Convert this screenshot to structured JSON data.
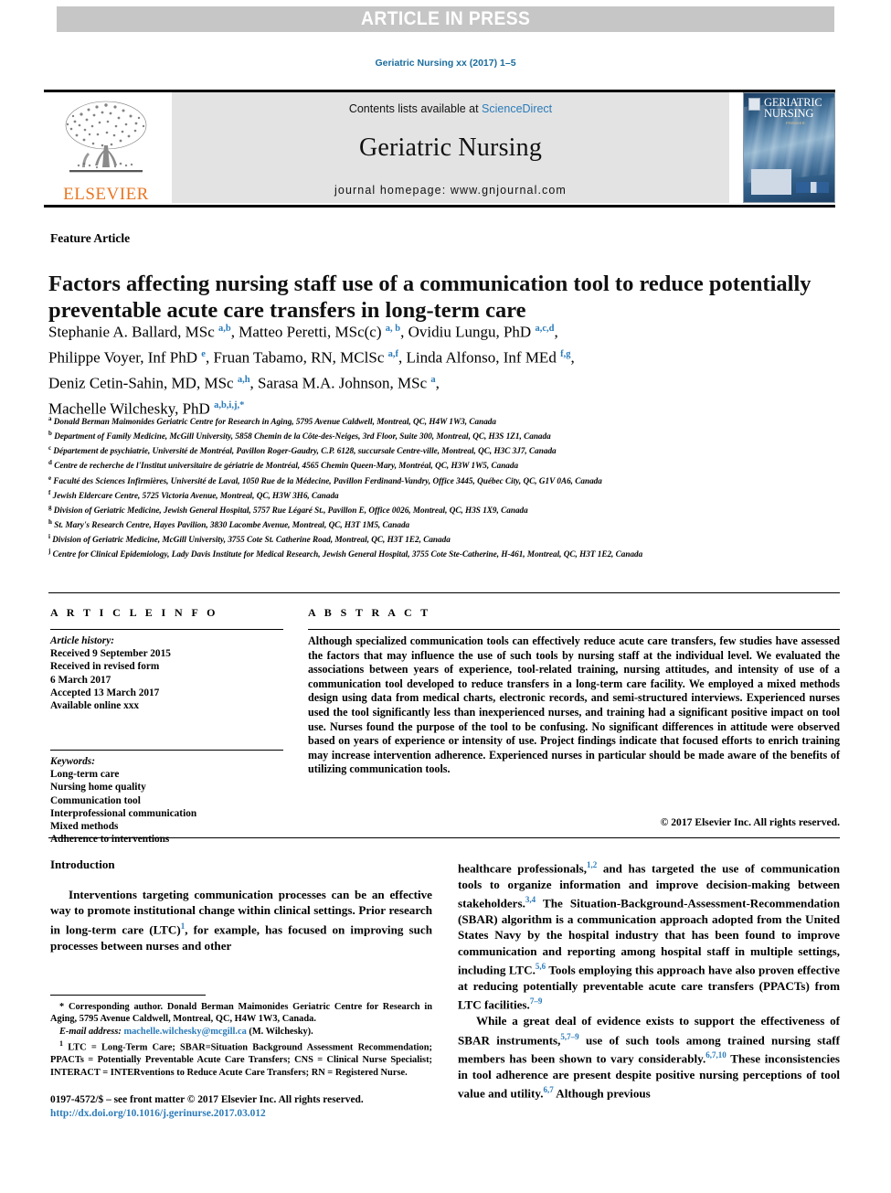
{
  "banner": {
    "text": "ARTICLE IN PRESS"
  },
  "running_head": "Geriatric Nursing xx (2017) 1–5",
  "masthead": {
    "contents_prefix": "Contents lists available at ",
    "sciencedirect": "ScienceDirect",
    "journal_title": "Geriatric Nursing",
    "homepage": "journal homepage: www.gnjournal.com",
    "publisher_wordmark": "ELSEVIER",
    "cover_title_line1": "GERIATRIC",
    "cover_title_line2": "NURSING",
    "cover_subtitle": "PREMIER"
  },
  "article": {
    "type_label": "Feature Article",
    "title": "Factors affecting nursing staff use of a communication tool to reduce potentially preventable acute care transfers in long-term care",
    "authors_html": "Stephanie A. Ballard, MSc <sup>a,b</sup>, Matteo Peretti, MSc(c) <sup>a, b</sup>, Ovidiu Lungu, PhD <sup>a,c,d</sup>,<br>Philippe Voyer, Inf PhD <sup>e</sup>, Fruan Tabamo, RN, MClSc <sup>a,f</sup>, Linda Alfonso, Inf MEd <sup>f,g</sup>,<br>Deniz Cetin-Sahin, MD, MSc <sup>a,h</sup>, Sarasa M.A. Johnson, MSc <sup>a</sup>,<br>Machelle Wilchesky, PhD <sup>a,b,i,j,</sup><sup>*</sup>"
  },
  "affiliations": [
    {
      "mark": "a",
      "text": "Donald Berman Maimonides Geriatric Centre for Research in Aging, 5795 Avenue Caldwell, Montreal, QC, H4W 1W3, Canada"
    },
    {
      "mark": "b",
      "text": "Department of Family Medicine, McGill University, 5858 Chemin de la Côte-des-Neiges, 3rd Floor, Suite 300, Montreal, QC, H3S 1Z1, Canada"
    },
    {
      "mark": "c",
      "text": "Département de psychiatrie, Université de Montréal, Pavillon Roger-Gaudry, C.P. 6128, succursale Centre-ville, Montreal, QC, H3C 3J7, Canada"
    },
    {
      "mark": "d",
      "text": "Centre de recherche de l'Institut universitaire de gériatrie de Montréal, 4565 Chemin Queen-Mary, Montréal, QC, H3W 1W5, Canada"
    },
    {
      "mark": "e",
      "text": "Faculté des Sciences Infirmières, Université de Laval, 1050 Rue de la Médecine, Pavillon Ferdinand-Vandry, Office 3445, Québec City, QC, G1V 0A6, Canada"
    },
    {
      "mark": "f",
      "text": "Jewish Eldercare Centre, 5725 Victoria Avenue, Montreal, QC, H3W 3H6, Canada"
    },
    {
      "mark": "g",
      "text": "Division of Geriatric Medicine, Jewish General Hospital, 5757 Rue Légaré St., Pavillon E, Office 0026, Montreal, QC, H3S 1X9, Canada"
    },
    {
      "mark": "h",
      "text": "St. Mary's Research Centre, Hayes Pavilion, 3830 Lacombe Avenue, Montreal, QC, H3T 1M5, Canada"
    },
    {
      "mark": "i",
      "text": "Division of Geriatric Medicine, McGill University, 3755 Cote St. Catherine Road, Montreal, QC, H3T 1E2, Canada"
    },
    {
      "mark": "j",
      "text": "Centre for Clinical Epidemiology, Lady Davis Institute for Medical Research, Jewish General Hospital, 3755 Cote Ste-Catherine, H-461, Montreal, QC, H3T 1E2, Canada"
    }
  ],
  "article_info": {
    "heading": "A R T I C L E  I N F O",
    "history_label": "Article history:",
    "history_lines": [
      "Received 9 September 2015",
      "Received in revised form",
      "6 March 2017",
      "Accepted 13 March 2017",
      "Available online xxx"
    ],
    "keywords_label": "Keywords:",
    "keywords": [
      "Long-term care",
      "Nursing home quality",
      "Communication tool",
      "Interprofessional communication",
      "Mixed methods",
      "Adherence to interventions"
    ]
  },
  "abstract": {
    "heading": "A B S T R A C T",
    "text": "Although specialized communication tools can effectively reduce acute care transfers, few studies have assessed the factors that may influence the use of such tools by nursing staff at the individual level. We evaluated the associations between years of experience, tool-related training, nursing attitudes, and intensity of use of a communication tool developed to reduce transfers in a long-term care facility. We employed a mixed methods design using data from medical charts, electronic records, and semi-structured interviews. Experienced nurses used the tool significantly less than inexperienced nurses, and training had a significant positive impact on tool use. Nurses found the purpose of the tool to be confusing. No significant differences in attitude were observed based on years of experience or intensity of use. Project findings indicate that focused efforts to enrich training may increase intervention adherence. Experienced nurses in particular should be made aware of the benefits of utilizing communication tools.",
    "copyright": "© 2017 Elsevier Inc. All rights reserved."
  },
  "body": {
    "section_title": "Introduction",
    "left_column_html": "Interventions targeting communication processes can be an effective way to promote institutional change within clinical settings. Prior research in long-term care (LTC)<sup>1</sup>, for example, has focused on improving such processes between nurses and other",
    "right_column_html": "healthcare professionals,<sup>1,2</sup> and has targeted the use of communication tools to organize information and improve decision-making between stakeholders.<sup>3,4</sup> The Situation-Background-Assessment-Recommendation (SBAR) algorithm is a communication approach adopted from the United States Navy by the hospital industry that has been found to improve communication and reporting among hospital staff in multiple settings, including LTC.<sup>5,6</sup> Tools employing this approach have also proven effective at reducing potentially preventable acute care transfers (PPACTs) from LTC facilities.<sup>7&ndash;9</sup>",
    "right_column_html2": "While a great deal of evidence exists to support the effectiveness of SBAR instruments,<sup>5,7&ndash;9</sup> use of such tools among trained nursing staff members has been shown to vary considerably.<sup>6,7,10</sup> These inconsistencies in tool adherence are present despite positive nursing perceptions of tool value and utility.<sup>6,7</sup> Although previous"
  },
  "footnotes": {
    "corresponding_html": "* Corresponding author. Donald Berman Maimonides Geriatric Centre for Research in Aging, 5795 Avenue Caldwell, Montreal, QC, H4W 1W3, Canada.",
    "email_label": "E-mail address:",
    "email": "machelle.wilchesky@mcgill.ca",
    "email_suffix": "(M. Wilchesky).",
    "abbrev_html": "<sup>1</sup> LTC = Long-Term Care; SBAR=Situation Background Assessment Recommendation; PPACTs = Potentially Preventable Acute Care Transfers; CNS = Clinical Nurse Specialist; INTERACT = INTERventions to Reduce Acute Care Transfers; RN = Registered Nurse."
  },
  "footer": {
    "issn_line": "0197-4572/$ – see front matter © 2017 Elsevier Inc. All rights reserved.",
    "doi": "http://dx.doi.org/10.1016/j.gerinurse.2017.03.012"
  },
  "colors": {
    "link": "#2b7bb9",
    "banner_bg": "#c6c6c6",
    "masthead_bg": "#e3e3e3",
    "elsevier_orange": "#e87722",
    "running_head": "#1a6c9c"
  }
}
